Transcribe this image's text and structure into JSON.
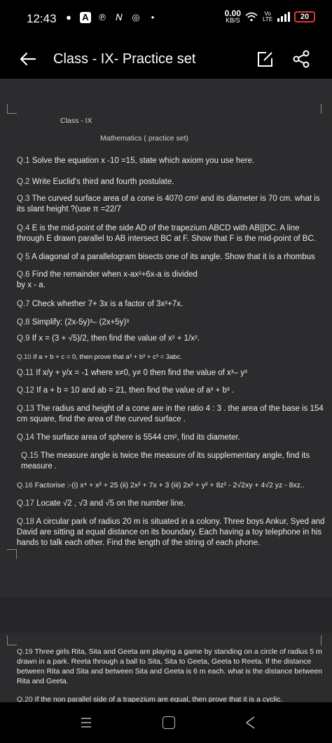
{
  "status_bar": {
    "time": "12:43",
    "net_speed_value": "0.00",
    "net_speed_unit": "KB/S",
    "volte": "Vo LTE",
    "battery": "20"
  },
  "app_bar": {
    "title": "Class - IX- Practice set"
  },
  "document": {
    "class_label": "Class - IX",
    "subject_label": "Mathematics ( practice set)",
    "questions": [
      {
        "num": "Q.1",
        "text": " Solve the equation x -10 =15, state which axiom you use here."
      },
      {
        "num": "Q.2",
        "text": " Write Euclid's third and fourth postulate."
      },
      {
        "num": "Q.3",
        "text": " The curved surface area of a cone is 4070 cm² and its diameter is 70 cm. what is its slant height ?(use π =22/7"
      },
      {
        "num": "Q.4",
        "text": "  E is the mid-point of the side AD of the trapezium ABCD with AB||DC. A line through E drawn parallel to AB intersect BC at F. Show that F is the mid-point of BC."
      },
      {
        "num": "Q 5",
        "text": " A diagonal of a parallelogram bisects one of its angle. Show that it is a rhombus"
      },
      {
        "num": "Q.6",
        "text": " Find the remainder when x-ax²+6x-a is divided by x - a."
      },
      {
        "num": "Q.7",
        "text": " Check whether 7+ 3x is a factor of 3x²+7x."
      },
      {
        "num": "Q.8",
        "text": "  Simplify:  (2x-5y)³– (2x+5y)³"
      },
      {
        "num": "Q.9",
        "text": " If x = (3 + √5)/2, then find the value of  x² + 1/x²."
      },
      {
        "num": "Q.10",
        "text": " If a + b + c = 0, then prove that a³ + b³ + c³ = 3abc."
      },
      {
        "num": "Q.11",
        "text": "  If x/y + y/x = -1 where x≠0, y≠ 0 then find the value of x³– y³"
      },
      {
        "num": "Q.12",
        "text": " If a + b = 10 and ab = 21, then find the value of a³ + b³ ."
      },
      {
        "num": "Q.13",
        "text": " The radius and height of a cone are in the ratio 4 : 3 . the area of the base is 154 cm square, find the area of the curved surface ."
      },
      {
        "num": "Q.14",
        "text": " The surface area of sphere is 5544 cm², find its diameter."
      },
      {
        "num": "Q.15",
        "text": " The measure angle is twice the measure of its supplementary angle, find its measure ."
      },
      {
        "num": "Q.16",
        "text": " Factorise :-(i) x⁴ + x² + 25  (ii) 2x² + 7x + 3 (iii) 2x² + y² + 8z² - 2√2xy + 4√2 yz - 8xz.."
      },
      {
        "num": "Q.17",
        "text": " Locate √2 , √3 and √5 on the number line."
      },
      {
        "num": "Q.18",
        "text": " A circular park of radius 20 m is situated in a colony. Three boys Ankur, Syed and David are sitting at equal distance on its boundary. Each having a toy telephone in his hands to talk each other. Find the length of the string of each phone."
      },
      {
        "num": "Q.19",
        "text": " Three girls Rita, Sita and Geeta are playing a game by standing on a circle of radius 5 m drawn in a park. Reeta through a ball to Sita, Sita to Geeta, Geeta to Reeta. If the distance between Rita and Sita and between Sita and Geeta is 6 m each. what is the distance between Rita and Geeta."
      },
      {
        "num": "Q.20",
        "text": " If the non parallel side of a trapezium are equal, then prove that it is a cyclic."
      }
    ]
  }
}
